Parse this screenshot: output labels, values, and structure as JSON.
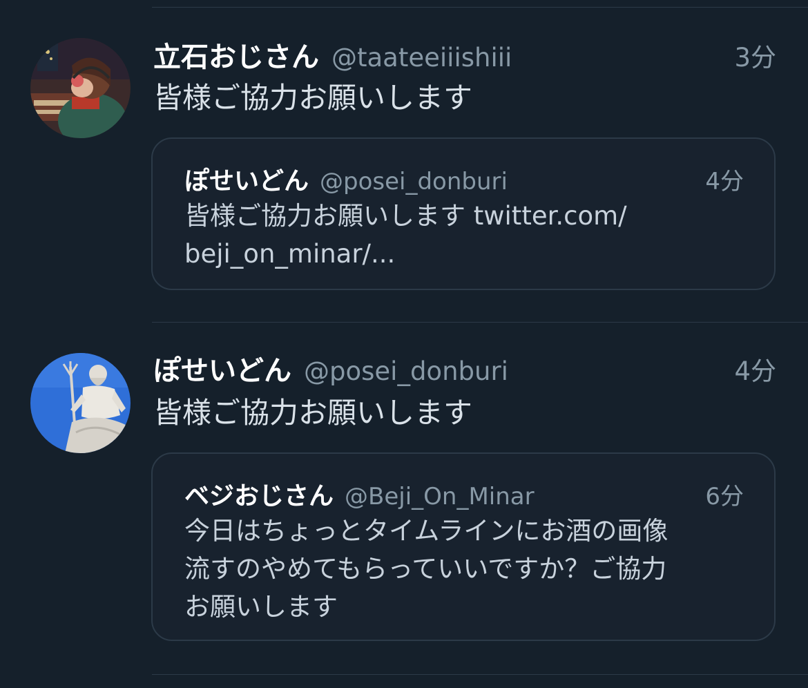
{
  "tweets": [
    {
      "author": {
        "name": "立石おじさん",
        "handle": "@taateeiiishiii"
      },
      "time": "3分",
      "text": "皆様ご協力お願いします",
      "avatar": {
        "icon": "avatar-lofi-girl",
        "colors": {
          "bg": "#3b2a2a",
          "accent": "#8b3a2e",
          "sweater": "#2f5d4f"
        }
      },
      "quote": {
        "author": {
          "name": "ぽせいどん",
          "handle": "@posei_donburi"
        },
        "time": "4分",
        "lines": [
          "皆様ご協力お願いします twitter.com/",
          "beji_on_minar/..."
        ]
      }
    },
    {
      "author": {
        "name": "ぽせいどん",
        "handle": "@posei_donburi"
      },
      "time": "4分",
      "text": "皆様ご協力お願いします",
      "avatar": {
        "icon": "avatar-poseidon-statue",
        "colors": {
          "bg": "#2f6fd8",
          "statue": "#e8e6e0"
        }
      },
      "quote": {
        "author": {
          "name": "ベジおじさん",
          "handle": "@Beji_On_Minar"
        },
        "time": "6分",
        "lines": [
          "今日はちょっとタイムラインにお酒の画像",
          "流すのやめてもらっていいですか？ご協力",
          "お願いします"
        ]
      }
    }
  ],
  "colors": {
    "background": "#15202b",
    "secondary_text": "#8899a6",
    "divider": "#2c3a48",
    "quote_background": "#18222e"
  }
}
